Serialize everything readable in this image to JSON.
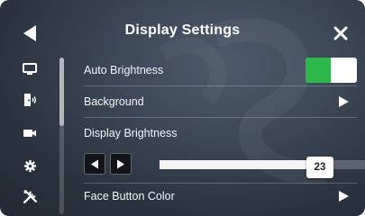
{
  "header": {
    "title": "Display Settings"
  },
  "icons": {
    "back": "back-arrow-icon",
    "close": "close-icon",
    "sidebar": [
      "monitor-icon",
      "door-sound-icon",
      "camera-icon",
      "gear-icon",
      "tools-icon"
    ]
  },
  "settings": {
    "auto_brightness": {
      "label": "Auto Brightness",
      "value": "on"
    },
    "background": {
      "label": "Background"
    },
    "display_brightness": {
      "label": "Display Brightness",
      "value": "23",
      "level": 0.78
    },
    "face_button_color": {
      "label": "Face Button Color"
    }
  },
  "colors": {
    "toggle_on": "#2db84a",
    "text": "#ffffff"
  }
}
